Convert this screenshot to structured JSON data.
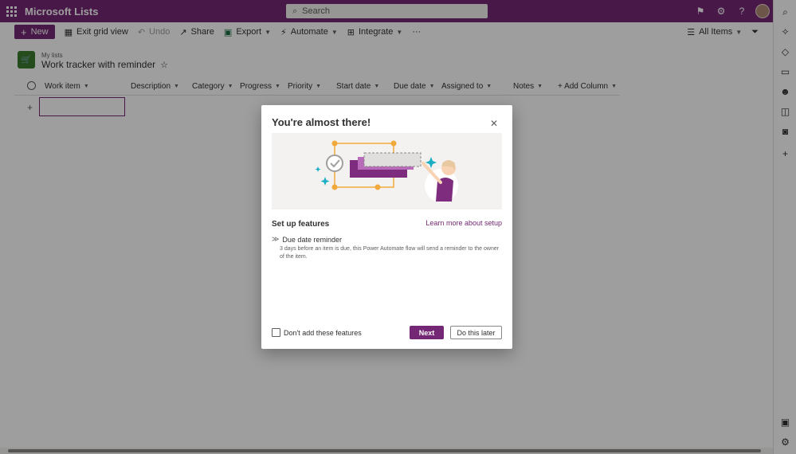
{
  "app": {
    "title": "Microsoft Lists"
  },
  "search": {
    "placeholder": "Search"
  },
  "toolbar": {
    "new_label": "New",
    "exit_grid_label": "Exit grid view",
    "undo_label": "Undo",
    "share_label": "Share",
    "export_label": "Export",
    "automate_label": "Automate",
    "integrate_label": "Integrate",
    "more_label": "···",
    "view_label": "All Items"
  },
  "list": {
    "breadcrumb": "My lists",
    "title": "Work tracker with reminder"
  },
  "columns": [
    {
      "label": "Work item"
    },
    {
      "label": "Description"
    },
    {
      "label": "Category"
    },
    {
      "label": "Progress"
    },
    {
      "label": "Priority"
    },
    {
      "label": "Start date"
    },
    {
      "label": "Due date"
    },
    {
      "label": "Assigned to"
    },
    {
      "label": "Notes"
    },
    {
      "label": "+ Add Column"
    }
  ],
  "dialog": {
    "title": "You're almost there!",
    "setup_label": "Set up features",
    "learn_link": "Learn more about setup",
    "feature_title": "Due date reminder",
    "feature_desc": "3 days before an item is due, this Power Automate flow will send a reminder to the owner of the item.",
    "checkbox_label": "Don't add these features",
    "next_label": "Next",
    "later_label": "Do this later"
  },
  "icons": {
    "suite": [
      "flag-icon",
      "gear-icon",
      "help-icon"
    ],
    "rail": [
      "search-icon",
      "copilot-icon",
      "tag-icon",
      "briefcase-icon",
      "people-icon",
      "office-icon",
      "outlook-icon",
      "add-icon",
      "sidebar-icon",
      "settings-icon"
    ]
  },
  "colors": {
    "accent": "#742774",
    "list_icon": "#3b7b30"
  }
}
